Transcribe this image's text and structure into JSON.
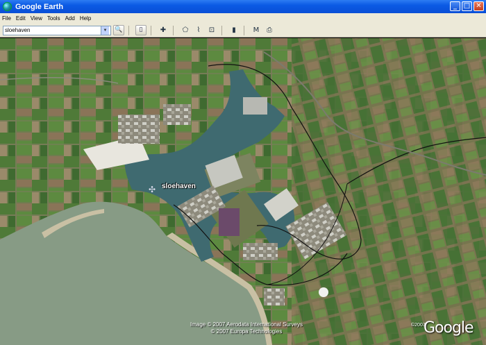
{
  "window": {
    "title": "Google Earth",
    "app_icon": "globe-icon",
    "controls": {
      "minimize": "_",
      "maximize": "□",
      "close": "✕"
    }
  },
  "menu": {
    "items": [
      "File",
      "Edit",
      "View",
      "Tools",
      "Add",
      "Help"
    ]
  },
  "toolbar": {
    "search": {
      "value": "sloehaven",
      "dropdown_glyph": "▼"
    },
    "search_button": "🔍",
    "buttons": [
      {
        "name": "sidebar-toggle-icon",
        "glyph": "▯"
      },
      {
        "name": "placemark-icon",
        "glyph": "✚"
      },
      {
        "name": "polygon-icon",
        "glyph": "⬠"
      },
      {
        "name": "path-icon",
        "glyph": "⌇"
      },
      {
        "name": "overlay-icon",
        "glyph": "⊡"
      },
      {
        "name": "ruler-icon",
        "glyph": "▮"
      },
      {
        "name": "email-icon",
        "glyph": "M"
      },
      {
        "name": "print-icon",
        "glyph": "⎙"
      }
    ]
  },
  "map": {
    "place_label": "sloehaven",
    "pin_glyph": "✣",
    "credits": [
      "Image © 2007 Aerodata International Surveys",
      "© 2007 Europa Technologies"
    ],
    "logo_year": "©2007",
    "logo_text": "Google",
    "colors": {
      "sea": "#879b85",
      "harbor_water": "#3f6a70",
      "farmland": "#6e7d4e",
      "field_green": "#4f7a38",
      "field_brown": "#8a7458",
      "beach": "#c9c0a4",
      "boundary": "#111111"
    }
  }
}
